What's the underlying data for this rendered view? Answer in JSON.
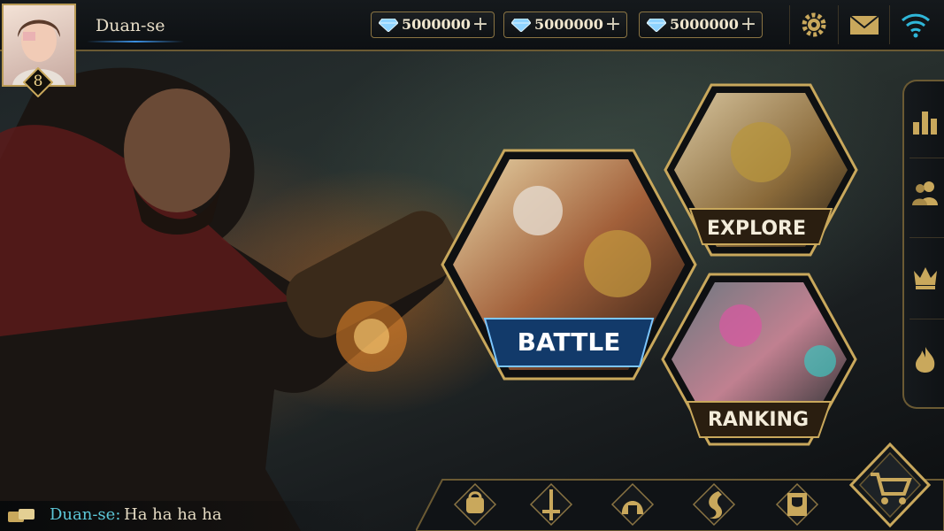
{
  "player": {
    "name": "Duan-se",
    "level": "8"
  },
  "currencies": [
    {
      "icon": "diamond-icon",
      "amount": "5000000"
    },
    {
      "icon": "diamond-icon",
      "amount": "5000000"
    },
    {
      "icon": "diamond-icon",
      "amount": "5000000"
    }
  ],
  "top_icons": [
    "settings-gear-icon",
    "mail-icon",
    "wifi-icon"
  ],
  "modes": {
    "battle": "BATTLE",
    "explore": "EXPLORE",
    "ranking": "RANKING"
  },
  "side_menu": [
    "leaderboard-bars-icon",
    "friends-icon",
    "crown-icon",
    "flame-icon"
  ],
  "bottom_menu": [
    "backpack-icon",
    "sword-icon",
    "helmet-icon",
    "dragon-icon",
    "trophy-book-icon"
  ],
  "chat": {
    "sender": "Duan-se:",
    "message": "Ha ha ha ha"
  },
  "colors": {
    "gold": "#c9a85c",
    "accent_blue": "#3b8fe0",
    "chat_name": "#5cc7d8"
  }
}
